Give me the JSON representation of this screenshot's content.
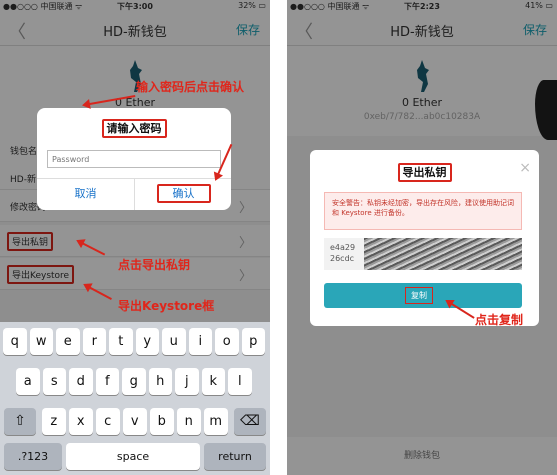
{
  "left": {
    "status": {
      "carrier": "●●○○○ 中国联通 ᯤ",
      "time": "下午3:00",
      "battery": "32% ▭"
    },
    "nav": {
      "back": "〈",
      "title": "HD-新钱包",
      "save": "保存"
    },
    "balance": "0 Ether",
    "rows": {
      "wallet_name": "钱包名",
      "hd": "HD-新",
      "change_pwd": "修改密码",
      "export_key": "导出私钥",
      "export_keystore": "导出Keystore",
      "chevron": "〉"
    },
    "dialog": {
      "title": "请输入密码",
      "placeholder": "Password",
      "cancel": "取消",
      "confirm": "确认"
    },
    "annotations": {
      "enter_pwd": "输入密码后点击确认",
      "click_export": "点击导出私钥",
      "export_keystore_box": "导出Keystore框"
    },
    "keyboard": {
      "row1": [
        "q",
        "w",
        "e",
        "r",
        "t",
        "y",
        "u",
        "i",
        "o",
        "p"
      ],
      "row2": [
        "a",
        "s",
        "d",
        "f",
        "g",
        "h",
        "j",
        "k",
        "l"
      ],
      "row3": [
        "z",
        "x",
        "c",
        "v",
        "b",
        "n",
        "m"
      ],
      "shift": "⇧",
      "delete": "⌫",
      "num": ".?123",
      "space": "space",
      "return": "return"
    }
  },
  "right": {
    "status": {
      "carrier": "●●○○○ 中国联通 ᯤ",
      "time": "下午2:23",
      "battery": "41% ▭"
    },
    "nav": {
      "back": "〈",
      "title": "HD-新钱包",
      "save": "保存"
    },
    "balance": "0 Ether",
    "address": "0xeb/7/782...ab0c10283A",
    "dialog": {
      "title": "导出私钥",
      "close": "×",
      "warning": "安全警告：私钥未经加密，导出存在风险，建议使用助记词和 Keystore 进行备份。",
      "key_line1": "e4a29",
      "key_line2": "26cdc",
      "copy": "复制"
    },
    "annotation": "点击复制",
    "bottom": "删除钱包"
  }
}
